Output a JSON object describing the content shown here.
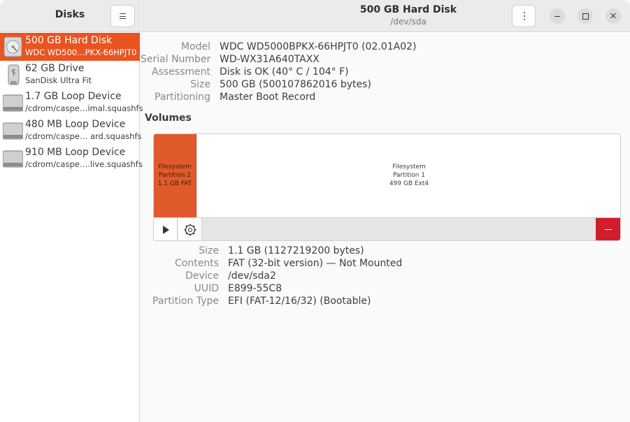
{
  "sidebar": {
    "title": "Disks",
    "menu_icon": "hamburger-menu-icon",
    "drives": [
      {
        "name": "500 GB Hard Disk",
        "sub": "WDC WD500…PKX-66HPJT0",
        "icon": "hard-disk-icon",
        "selected": true
      },
      {
        "name": "62 GB Drive",
        "sub": "SanDisk Ultra Fit",
        "icon": "usb-drive-icon",
        "selected": false
      },
      {
        "name": "1.7 GB Loop Device",
        "sub": "/cdrom/caspe…imal.squashfs",
        "icon": "loop-device-icon",
        "selected": false
      },
      {
        "name": "480 MB Loop Device",
        "sub": "/cdrom/caspe… ard.squashfs",
        "icon": "loop-device-icon",
        "selected": false
      },
      {
        "name": "910 MB Loop Device",
        "sub": "/cdrom/caspe….live.squashfs",
        "icon": "loop-device-icon",
        "selected": false
      }
    ]
  },
  "header": {
    "title": "500 GB Hard Disk",
    "subtitle": "/dev/sda"
  },
  "disk_info": [
    {
      "label": "Model",
      "value": "WDC WD5000BPKX-66HPJT0 (02.01A02)"
    },
    {
      "label": "Serial Number",
      "value": "WD-WX31A640TAXX"
    },
    {
      "label": "Assessment",
      "value": "Disk is OK (40° C / 104° F)"
    },
    {
      "label": "Size",
      "value": "500 GB (500107862016 bytes)"
    },
    {
      "label": "Partitioning",
      "value": "Master Boot Record"
    }
  ],
  "volumes": {
    "heading": "Volumes",
    "partitions": [
      {
        "line1": "Filesystem",
        "line2": "Partition 2",
        "line3": "1.1 GB FAT",
        "selected": true,
        "color": "#e05a2b"
      },
      {
        "line1": "Filesystem",
        "line2": "Partition 1",
        "line3": "499 GB Ext4",
        "selected": false,
        "color": "#ffffff"
      }
    ]
  },
  "partition_info": [
    {
      "label": "Size",
      "value": "1.1 GB (1127219200 bytes)"
    },
    {
      "label": "Contents",
      "value": "FAT (32-bit version) — Not Mounted"
    },
    {
      "label": "Device",
      "value": "/dev/sda2"
    },
    {
      "label": "UUID",
      "value": "E899-55C8"
    },
    {
      "label": "Partition Type",
      "value": "EFI (FAT-12/16/32) (Bootable)"
    }
  ],
  "colors": {
    "accent": "#e95420",
    "delete": "#d11d2d"
  }
}
